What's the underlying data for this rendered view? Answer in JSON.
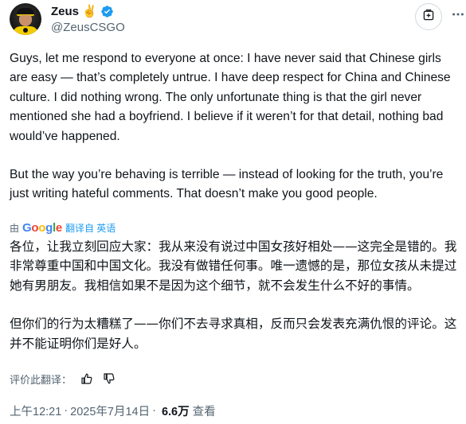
{
  "author": {
    "display_name": "Zeus",
    "emoji": "✌️",
    "handle": "@ZeusCSGO",
    "verified": true,
    "verified_color": "#1d9bf0"
  },
  "tweet": {
    "paragraph_1": "Guys, let me respond to everyone at once: I have never said that Chinese girls are easy — that’s completely untrue. I have deep respect for China and Chinese culture. I did nothing wrong. The only unfortunate thing is that the girl never mentioned she had a boyfriend. I believe if it weren’t for that detail, nothing bad would’ve happened.",
    "paragraph_2": "But the way you’re behaving is terrible — instead of looking for the truth, you’re just writing hateful comments. That doesn’t make you good people."
  },
  "translation": {
    "prefix": "由",
    "provider": "Google",
    "action": "翻译自 英语",
    "paragraph_1": "各位，让我立刻回应大家：我从来没有说过中国女孩好相处——这完全是错的。我非常尊重中国和中国文化。我没有做错任何事。唯一遗憾的是，那位女孩从未提过她有男朋友。我相信如果不是因为这个细节，就不会发生什么不好的事情。",
    "paragraph_2": "但你们的行为太糟糕了——你们不去寻求真相，反而只会发表充满仇恨的评论。这并不能证明你们是好人。",
    "rate_label": "评价此翻译："
  },
  "meta": {
    "time": "上午12:21",
    "separator": "·",
    "date": "2025年7月14日",
    "views": "6.6万",
    "views_label": "查看"
  },
  "icons": {
    "subscribe": "subscribe-icon",
    "more": "more-options-icon",
    "thumbs_up": "thumbs-up-icon",
    "thumbs_down": "thumbs-down-icon"
  },
  "colors": {
    "text_primary": "#0f1419",
    "text_secondary": "#536471",
    "accent": "#1d9bf0",
    "google_blue": "#4285f4",
    "google_red": "#ea4335",
    "google_yellow": "#fbbc05",
    "google_green": "#34a853"
  }
}
